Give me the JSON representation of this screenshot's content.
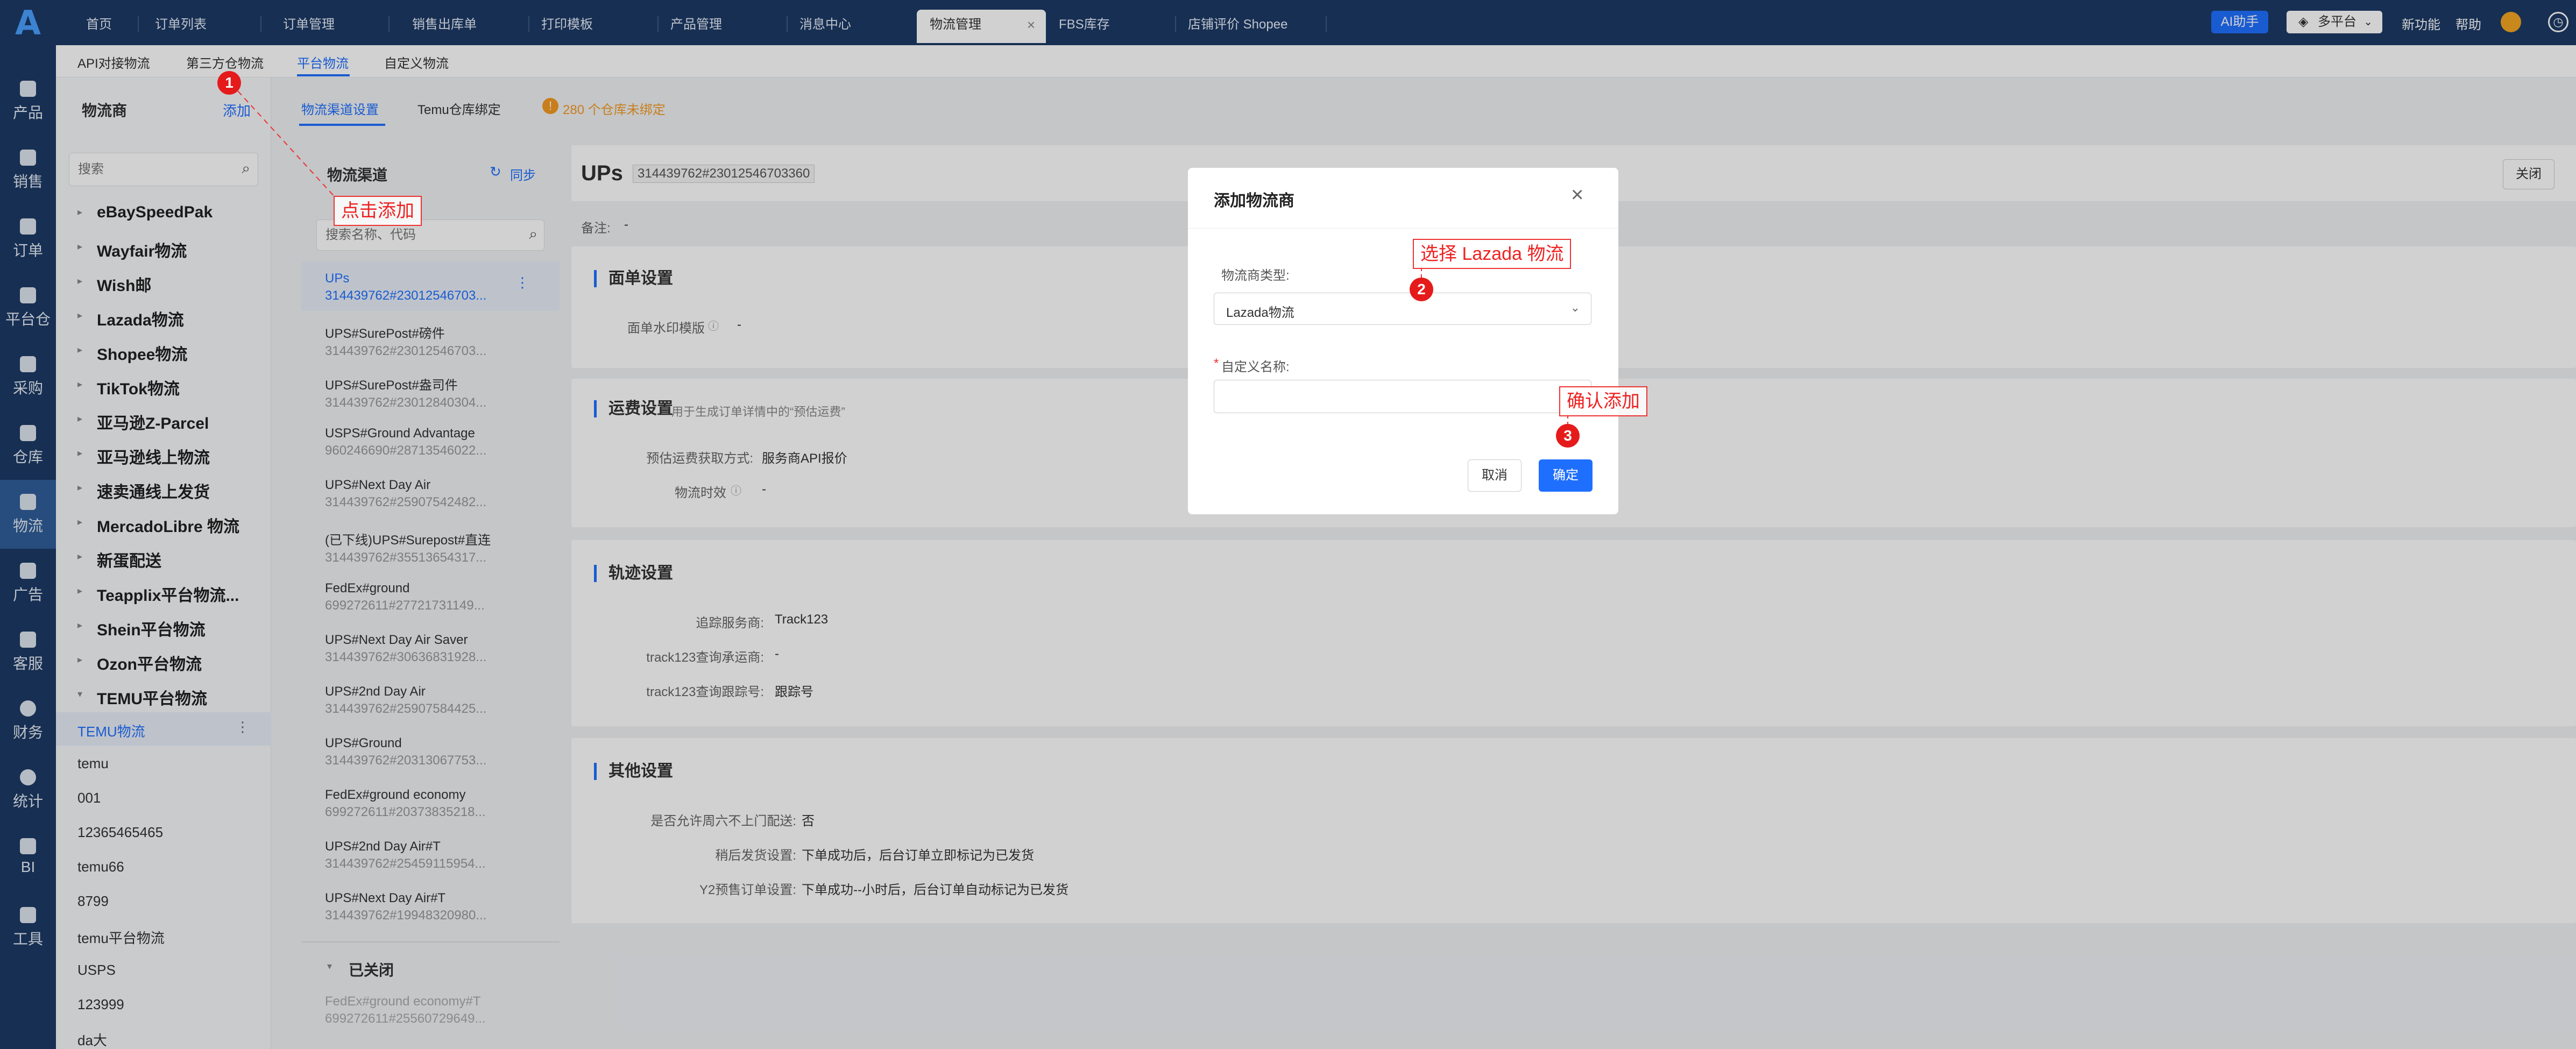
{
  "topbar": {
    "tabs": [
      {
        "label": "首页"
      },
      {
        "label": "订单列表"
      },
      {
        "label": "订单管理"
      },
      {
        "label": "销售出库单"
      },
      {
        "label": "打印模板"
      },
      {
        "label": "产品管理"
      },
      {
        "label": "消息中心"
      },
      {
        "label": "物流管理"
      },
      {
        "label": "FBS库存"
      },
      {
        "label": "店铺评价 Shopee"
      }
    ],
    "ai_label": "AI助手",
    "platform_label": "多平台",
    "new_feature": "新功能",
    "help": "帮助"
  },
  "leftnav": {
    "items": [
      {
        "label": "产品"
      },
      {
        "label": "销售"
      },
      {
        "label": "订单"
      },
      {
        "label": "平台仓"
      },
      {
        "label": "采购"
      },
      {
        "label": "仓库"
      },
      {
        "label": "物流"
      },
      {
        "label": "广告"
      },
      {
        "label": "客服"
      },
      {
        "label": "财务"
      },
      {
        "label": "统计"
      },
      {
        "label": "BI"
      },
      {
        "label": "工具"
      }
    ]
  },
  "subtabs": [
    {
      "label": "API对接物流"
    },
    {
      "label": "第三方仓物流"
    },
    {
      "label": "平台物流"
    },
    {
      "label": "自定义物流"
    }
  ],
  "provider": {
    "title": "物流商",
    "add": "添加",
    "search_placeholder": "搜索",
    "tree": [
      {
        "label": "eBaySpeedPak"
      },
      {
        "label": "Wayfair物流"
      },
      {
        "label": "Wish邮"
      },
      {
        "label": "Lazada物流"
      },
      {
        "label": "Shopee物流"
      },
      {
        "label": "TikTok物流"
      },
      {
        "label": "亚马逊Z-Parcel"
      },
      {
        "label": "亚马逊线上物流"
      },
      {
        "label": "速卖通线上发货"
      },
      {
        "label": "MercadoLibre 物流"
      },
      {
        "label": "新蛋配送"
      },
      {
        "label": "Teapplix平台物流..."
      },
      {
        "label": "Shein平台物流"
      },
      {
        "label": "Ozon平台物流"
      },
      {
        "label": "TEMU平台物流"
      }
    ],
    "children": [
      {
        "label": "TEMU物流"
      },
      {
        "label": "temu"
      },
      {
        "label": "001"
      },
      {
        "label": "12365465465"
      },
      {
        "label": "temu66"
      },
      {
        "label": "8799"
      },
      {
        "label": "temu平台物流"
      },
      {
        "label": "USPS"
      },
      {
        "label": "123999"
      },
      {
        "label": "da大"
      }
    ]
  },
  "middle_tabs": {
    "tab1": "物流渠道设置",
    "tab2": "Temu仓库绑定",
    "warning": "280 个仓库未绑定"
  },
  "channels": {
    "title": "物流渠道",
    "sync": "同步",
    "search_placeholder": "搜索名称、代码",
    "list": [
      {
        "name": "UPs",
        "id": "314439762#23012546703..."
      },
      {
        "name": "UPS#SurePost#磅件",
        "id": "314439762#23012546703..."
      },
      {
        "name": "UPS#SurePost#盎司件",
        "id": "314439762#23012840304..."
      },
      {
        "name": "USPS#Ground Advantage",
        "id": "960246690#28713546022..."
      },
      {
        "name": "UPS#Next Day Air",
        "id": "314439762#25907542482..."
      },
      {
        "name": "(已下线)UPS#Surepost#直连",
        "id": "314439762#35513654317..."
      },
      {
        "name": "FedEx#ground",
        "id": "699272611#27721731149..."
      },
      {
        "name": "UPS#Next Day Air Saver",
        "id": "314439762#30636831928..."
      },
      {
        "name": "UPS#2nd Day Air",
        "id": "314439762#25907584425..."
      },
      {
        "name": "UPS#Ground",
        "id": "314439762#20313067753..."
      },
      {
        "name": "FedEx#ground economy",
        "id": "699272611#20373835218..."
      },
      {
        "name": "UPS#2nd Day Air#T",
        "id": "314439762#25459115954..."
      },
      {
        "name": "UPS#Next Day Air#T",
        "id": "314439762#19948320980..."
      }
    ],
    "closed_label": "已关闭",
    "closed_item": {
      "name": "FedEx#ground economy#T",
      "id": "699272611#25560729649..."
    }
  },
  "detail": {
    "title": "UPs",
    "code": "314439762#23012546703360",
    "close_btn": "关闭",
    "remark_label": "备注:",
    "remark_val": "-",
    "sec1_title": "面单设置",
    "watermark_label": "面单水印模版",
    "watermark_val": "-",
    "sec2_title": "运费设置",
    "sec2_desc": "用于生成订单详情中的“预估运费”",
    "freight_label": "预估运费获取方式:",
    "freight_val": "服务商API报价",
    "aging_label": "物流时效",
    "aging_val": "-",
    "sec3_title": "轨迹设置",
    "track_svc_label": "追踪服务商:",
    "track_svc_val": "Track123",
    "track_carrier_label": "track123查询承运商:",
    "track_carrier_val": "-",
    "track_no_label": "track123查询跟踪号:",
    "track_no_val": "跟踪号",
    "sec4_title": "其他设置",
    "sat_label": "是否允许周六不上门配送:",
    "sat_val": "否",
    "later_label": "稍后发货设置:",
    "later_val": "下单成功后，后台订单立即标记为已发货",
    "y2_label": "Y2预售订单设置:",
    "y2_val": "下单成功--小时后，后台订单自动标记为已发货"
  },
  "modal": {
    "title": "添加物流商",
    "type_label": "物流商类型:",
    "type_val": "Lazada物流",
    "name_label": "自定义名称:",
    "name_placeholder": "",
    "cancel": "取消",
    "ok": "确定"
  },
  "annotations": {
    "note1": "点击添加",
    "note2": "选择 Lazada 物流",
    "note3": "确认添加",
    "m1": "1",
    "m2": "2",
    "m3": "3"
  },
  "colors": {
    "primary": "#1f6fff",
    "nav_bg": "#1d3a66",
    "annotation": "#e51b1b"
  }
}
